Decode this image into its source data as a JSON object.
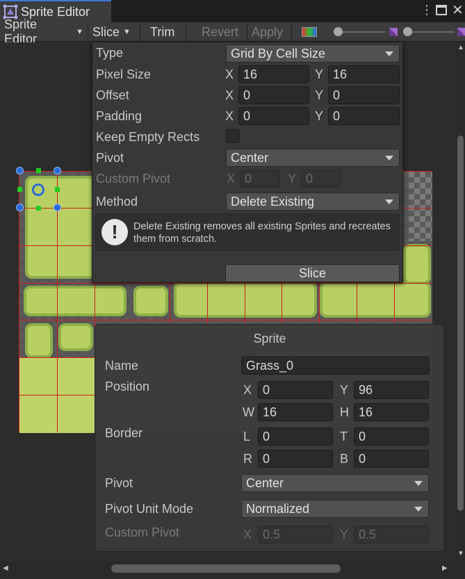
{
  "window": {
    "tab_title": "Sprite Editor"
  },
  "toolbar": {
    "sprite_editor": "Sprite Editor",
    "slice": "Slice",
    "trim": "Trim",
    "revert": "Revert",
    "apply": "Apply"
  },
  "slice_popup": {
    "type_label": "Type",
    "type_value": "Grid By Cell Size",
    "pixel_size_label": "Pixel Size",
    "pixel_size_x": "16",
    "pixel_size_y": "16",
    "offset_label": "Offset",
    "offset_x": "0",
    "offset_y": "0",
    "padding_label": "Padding",
    "padding_x": "0",
    "padding_y": "0",
    "keep_empty_label": "Keep Empty Rects",
    "pivot_label": "Pivot",
    "pivot_value": "Center",
    "custom_pivot_label": "Custom Pivot",
    "custom_pivot_x": "0",
    "custom_pivot_y": "0",
    "method_label": "Method",
    "method_value": "Delete Existing",
    "help_text": "Delete Existing removes all existing Sprites and recreates them from scratch.",
    "slice_button": "Slice",
    "x": "X",
    "y": "Y"
  },
  "sprite_panel": {
    "title": "Sprite",
    "name_label": "Name",
    "name_value": "Grass_0",
    "position_label": "Position",
    "pos_x_axis": "X",
    "pos_x": "0",
    "pos_y_axis": "Y",
    "pos_y": "96",
    "pos_w_axis": "W",
    "pos_w": "16",
    "pos_h_axis": "H",
    "pos_h": "16",
    "border_label": "Border",
    "border_l_axis": "L",
    "border_l": "0",
    "border_t_axis": "T",
    "border_t": "0",
    "border_r_axis": "R",
    "border_r": "0",
    "border_b_axis": "B",
    "border_b": "0",
    "pivot_label": "Pivot",
    "pivot_value": "Center",
    "pivot_unit_label": "Pivot Unit Mode",
    "pivot_unit_value": "Normalized",
    "custom_pivot_label": "Custom Pivot",
    "cp_x_axis": "X",
    "cp_x": "0.5",
    "cp_y_axis": "Y",
    "cp_y": "0.5"
  }
}
